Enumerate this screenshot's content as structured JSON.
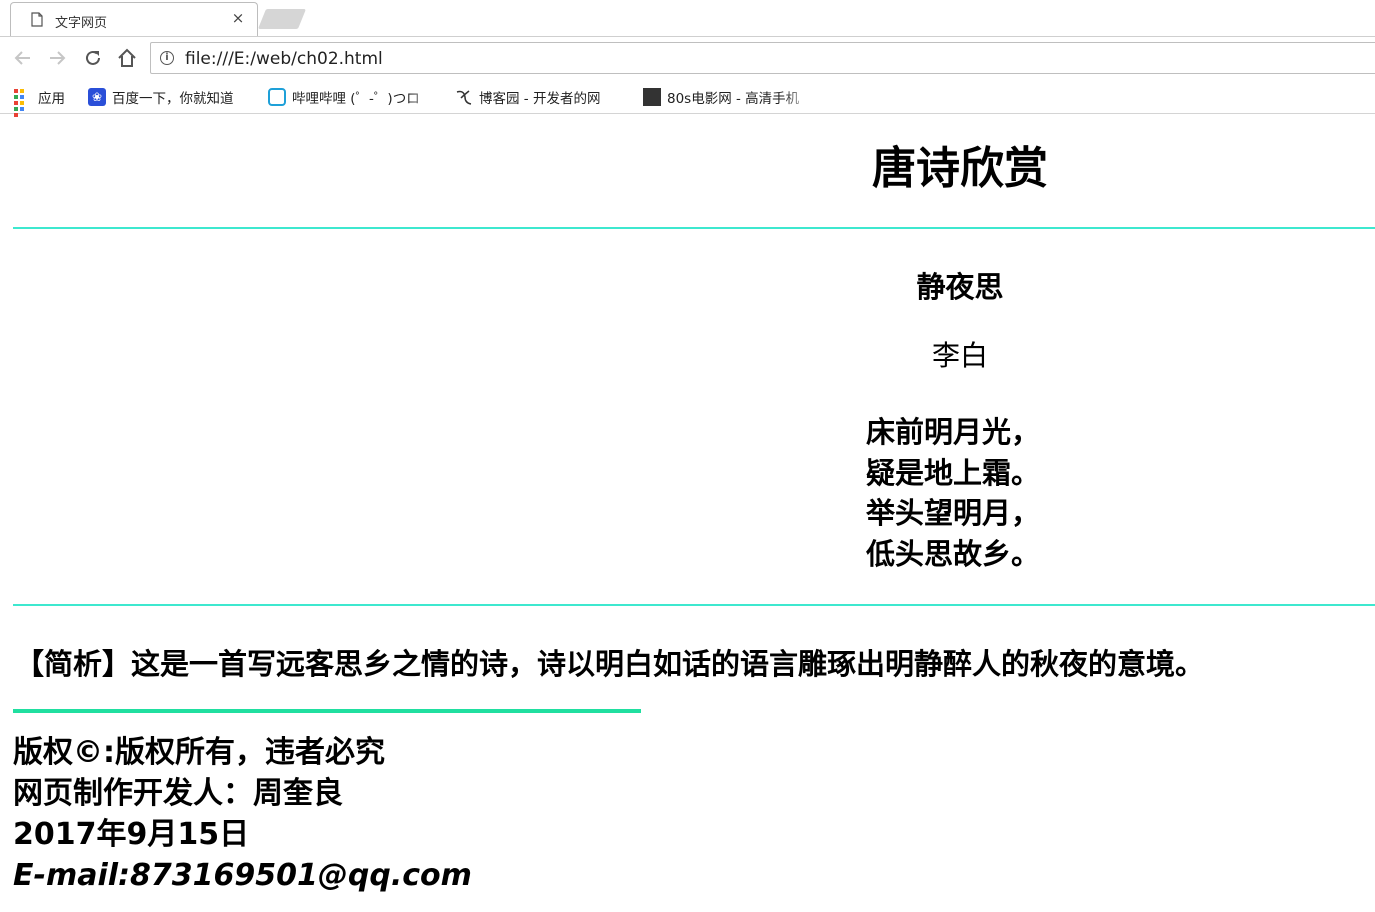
{
  "browser": {
    "tab_title": "文字网页",
    "tab_close_glyph": "×",
    "url": "file:///E:/web/ch02.html",
    "bookmarks": [
      {
        "label": "应用",
        "icon": "apps-grid-icon"
      },
      {
        "label": "百度一下，你就知道",
        "icon": "baidu-paw-icon"
      },
      {
        "label": "哔哩哔哩 (゜-゜)つロ",
        "icon": "bilibili-tv-icon"
      },
      {
        "label": "博客园 - 开发者的网",
        "icon": "cnblogs-icon"
      },
      {
        "label": "80s电影网 - 高清手机",
        "icon": "clapperboard-icon"
      }
    ]
  },
  "page": {
    "title": "唐诗欣赏",
    "poem": {
      "title": "静夜思",
      "author": "李白",
      "lines": [
        "床前明月光，",
        "疑是地上霜。",
        "举头望明月，",
        "低头思故乡。"
      ]
    },
    "analysis": "【简析】这是一首写远客思乡之情的诗，诗以明白如话的语言雕琢出明静醉人的秋夜的意境。",
    "footer": {
      "copyright": "版权©:版权所有，违者必究",
      "developer": "网页制作开发人：周奎良",
      "date": "2017年9月15日",
      "email": "E-mail:873169501@qq.com"
    }
  },
  "colors": {
    "rule_top": "#3de8cf",
    "rule_bottom": "#20dfa0"
  }
}
